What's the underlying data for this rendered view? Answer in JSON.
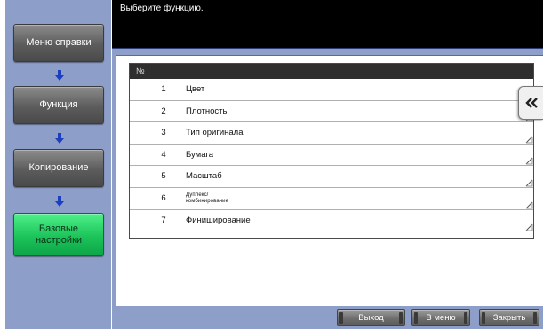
{
  "header": {
    "message": "Выберите функцию."
  },
  "nav": {
    "items": [
      {
        "label": "Меню справки"
      },
      {
        "label": "Функция"
      },
      {
        "label": "Копирование"
      },
      {
        "label": "Базовые\nнастройки"
      }
    ]
  },
  "table": {
    "header": "№",
    "rows": [
      {
        "num": "1",
        "label": "Цвет"
      },
      {
        "num": "2",
        "label": "Плотность"
      },
      {
        "num": "3",
        "label": "Тип оригинала"
      },
      {
        "num": "4",
        "label": "Бумага"
      },
      {
        "num": "5",
        "label": "Масштаб"
      },
      {
        "num": "6",
        "label": "Дуплекс/\nкомбинирование"
      },
      {
        "num": "7",
        "label": "Финиширование"
      }
    ]
  },
  "buttons": {
    "exit": "Выход",
    "menu": "В меню",
    "close": "Закрыть"
  },
  "icons": {
    "nav_arrow": "down-arrow-icon",
    "collapse": "double-chevron-left-icon",
    "row_corner": "corner-mark-icon"
  },
  "colors": {
    "panel_blue": "#8d9fc9",
    "active_green": "#1bc45a",
    "arrow_blue": "#1c3fc0"
  }
}
